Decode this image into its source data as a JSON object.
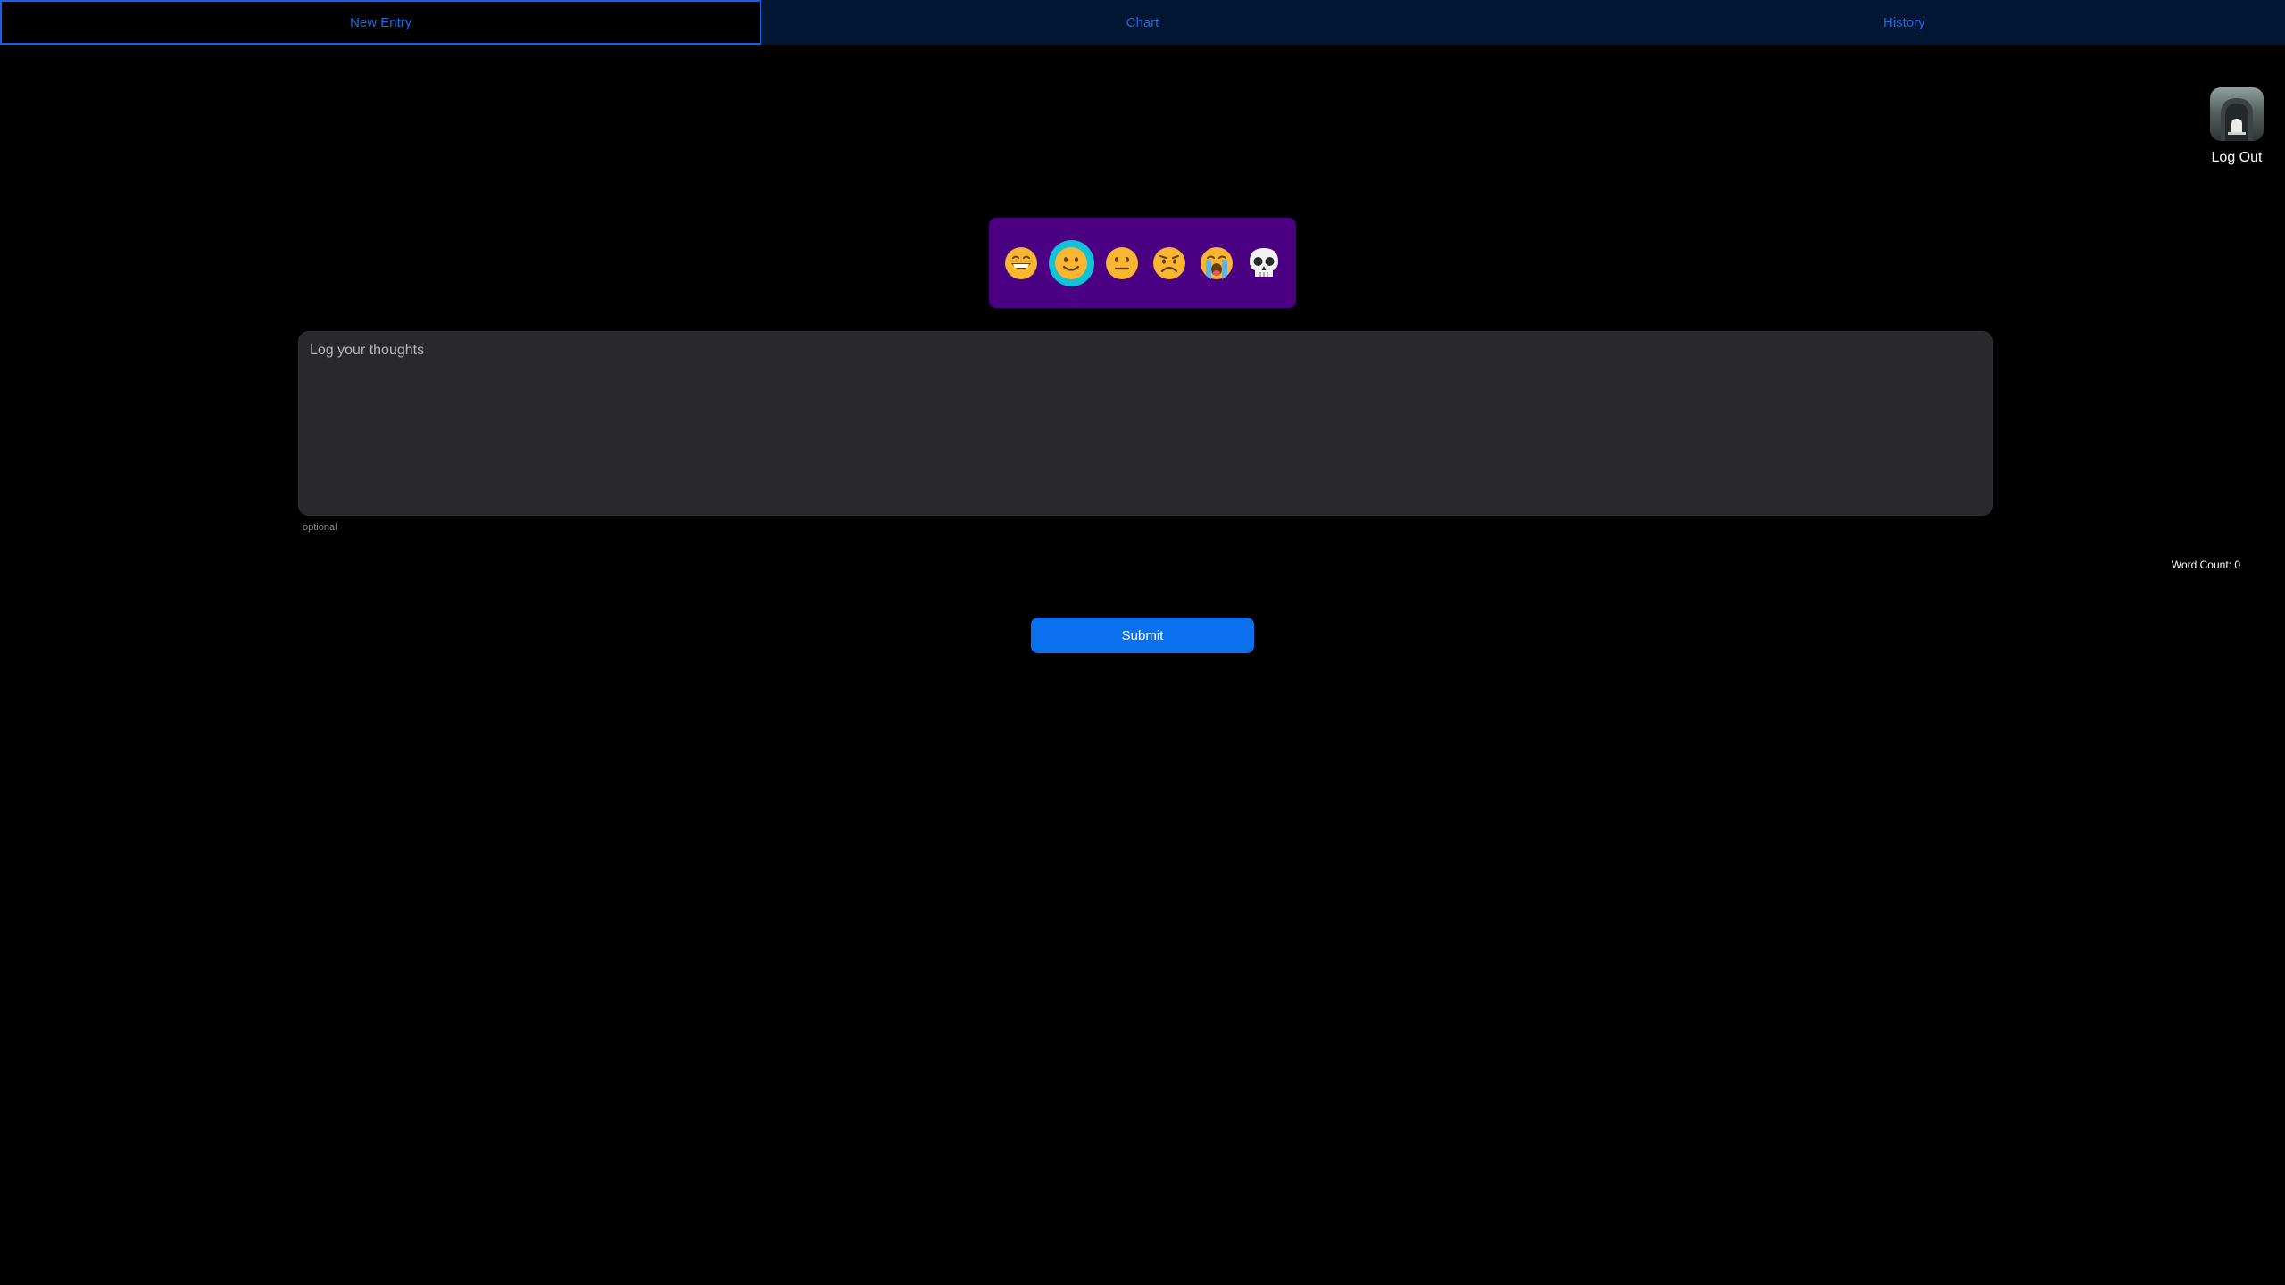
{
  "tabs": [
    {
      "label": "New Entry",
      "active": true
    },
    {
      "label": "Chart",
      "active": false
    },
    {
      "label": "History",
      "active": false
    }
  ],
  "logout": {
    "label": "Log Out",
    "icon": "tombstone-avatar-icon"
  },
  "moods": [
    {
      "name": "grinning-face-icon",
      "selected": false
    },
    {
      "name": "slightly-smiling-face-icon",
      "selected": true
    },
    {
      "name": "neutral-face-icon",
      "selected": false
    },
    {
      "name": "frowning-face-icon",
      "selected": false
    },
    {
      "name": "loudly-crying-face-icon",
      "selected": false
    },
    {
      "name": "skull-icon",
      "selected": false
    }
  ],
  "entry": {
    "placeholder": "Log your thoughts",
    "value": "",
    "hint": "optional"
  },
  "word_count": "Word Count: 0",
  "submit_label": "Submit",
  "colors": {
    "tabbar_bg": "#001633",
    "tab_text": "#1b6ae0",
    "mood_panel_bg": "#4b0083",
    "mood_selected_bg": "#12c2d8",
    "textarea_bg": "#29292b",
    "submit_bg": "#0b70ee"
  }
}
